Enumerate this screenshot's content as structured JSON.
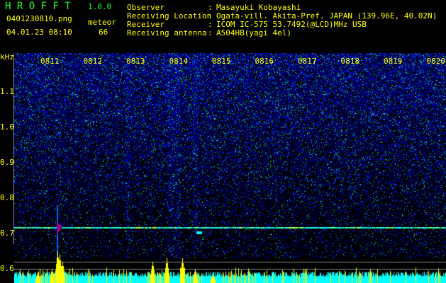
{
  "app": {
    "title": "H R O F F T",
    "version": "1.0.0"
  },
  "file": {
    "name": "0401230810.png",
    "datetime": "04.01.23 08:10"
  },
  "meteor": {
    "label": "meteor",
    "count": "66"
  },
  "info": [
    {
      "label": "Observer",
      "value": "Masayuki Kobayashi"
    },
    {
      "label": "Receiving Location",
      "value": "Ogata-vill. Akita-Pref. JAPAN (139.96E, 40.02N)"
    },
    {
      "label": "Receiver",
      "value": "ICOM IC-575 53.7492(@LCD)MHz USB"
    },
    {
      "label": "Receiving antenna",
      "value": "A504HB(yagi 4el)"
    }
  ],
  "axis": {
    "unit": "kHz",
    "freq_labels": [
      "1.1",
      "1.0",
      "0.9",
      "0.8",
      "0.7",
      "0.6"
    ],
    "time_labels": [
      "0811",
      "0812",
      "0813",
      "0814",
      "0815",
      "0816",
      "0817",
      "0818",
      "0819",
      "0820"
    ]
  },
  "colors": {
    "text": "#ffff00",
    "title": "#22ff22",
    "carrier": "#00ffff",
    "bars": "#ffff00",
    "base": "#00ffff"
  }
}
